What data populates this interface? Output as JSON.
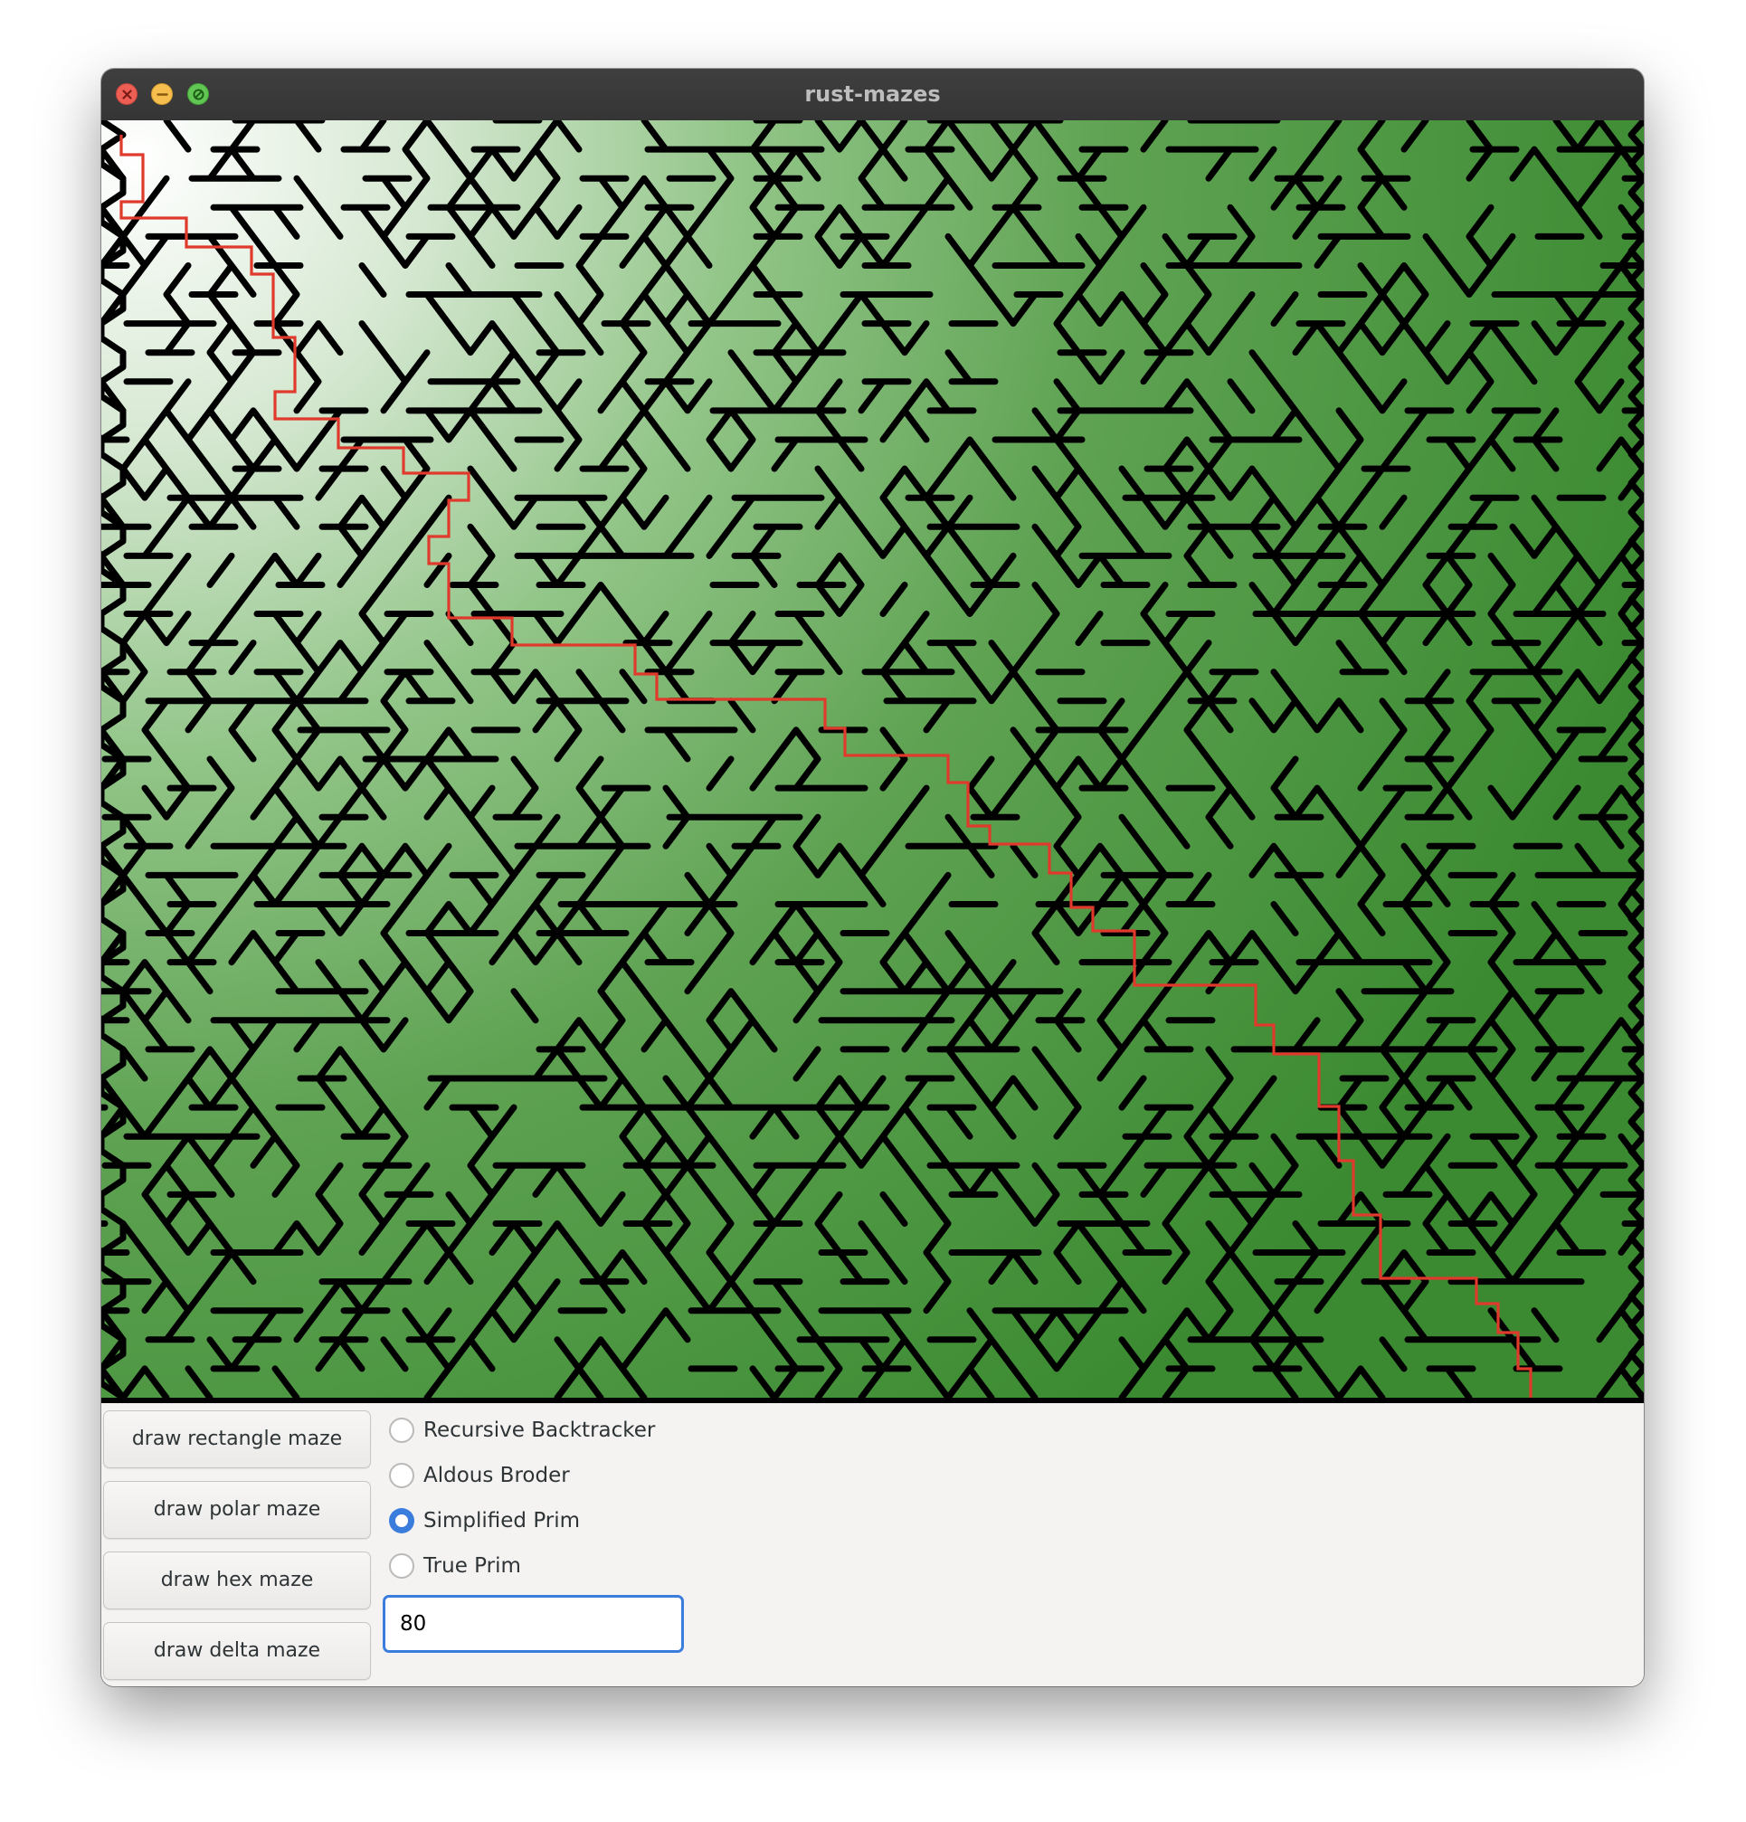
{
  "window": {
    "title": "rust-mazes"
  },
  "maze": {
    "kind": "delta",
    "size": 80,
    "wall_color": "#000000",
    "path_color": "#e03a2c",
    "gradient_start_color": "#ffffff",
    "gradient_end_color": "#3c8a30"
  },
  "buttons": {
    "rectangle": "draw rectangle maze",
    "polar": "draw polar maze",
    "hex": "draw hex maze",
    "delta": "draw delta maze"
  },
  "algorithms": [
    {
      "label": "Recursive Backtracker",
      "selected": false
    },
    {
      "label": "Aldous Broder",
      "selected": false
    },
    {
      "label": "Simplified Prim",
      "selected": true
    },
    {
      "label": "True Prim",
      "selected": false
    }
  ],
  "size_input": {
    "value": "80"
  },
  "colors": {
    "accent": "#3b7ddd",
    "titlebar": "#3a3a3a",
    "close": "#ed5f55",
    "minimize": "#f6be4f",
    "maximize": "#62c654"
  }
}
